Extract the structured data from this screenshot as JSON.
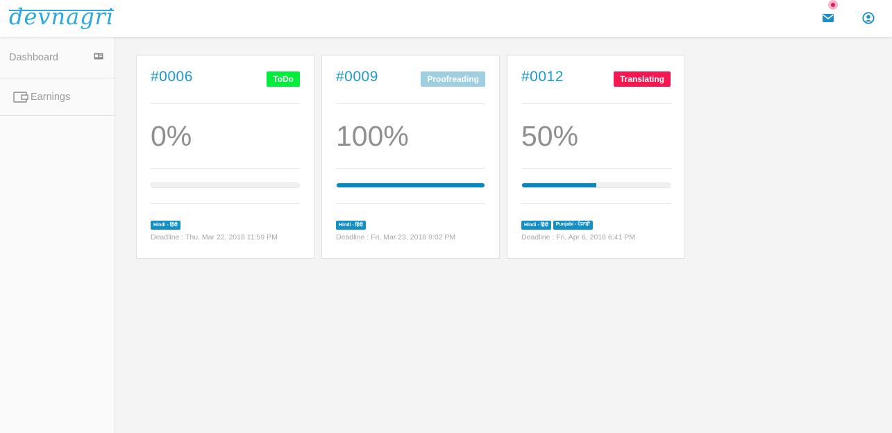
{
  "header": {
    "logo_text": "devnagri",
    "icons": [
      "mail-icon",
      "user-icon"
    ],
    "notification_color": "#e8194f"
  },
  "sidebar": {
    "items": [
      {
        "label": "Dashboard",
        "icon": "id-card-icon"
      },
      {
        "label": "Earnings",
        "icon": "wallet-icon"
      }
    ]
  },
  "cards": [
    {
      "number": "#0006",
      "status": "ToDo",
      "status_color": "#00ee3b",
      "percent_text": "0%",
      "progress": 0,
      "tags": [
        "Hindi - हिंदी"
      ],
      "deadline": "Deadline : Thu, Mar 22, 2018 11:59 PM"
    },
    {
      "number": "#0009",
      "status": "Proofreading",
      "status_color": "#9ecfe1",
      "percent_text": "100%",
      "progress": 1.0,
      "tags": [
        "Hindi - हिंदी"
      ],
      "deadline": "Deadline : Fri, Mar 23, 2018 9:02 PM"
    },
    {
      "number": "#0012",
      "status": "Translating",
      "status_color": "#f5174f",
      "percent_text": "50%",
      "progress": 0.5,
      "tags": [
        "Hindi - हिंदी",
        "Punjabi - ਪੰਜਾਬੀ"
      ],
      "deadline": "Deadline : Fri, Apr 6, 2018 6:41 PM"
    }
  ],
  "colors": {
    "accent": "#1d9bd1",
    "progress_fill": "#0a87bd"
  }
}
